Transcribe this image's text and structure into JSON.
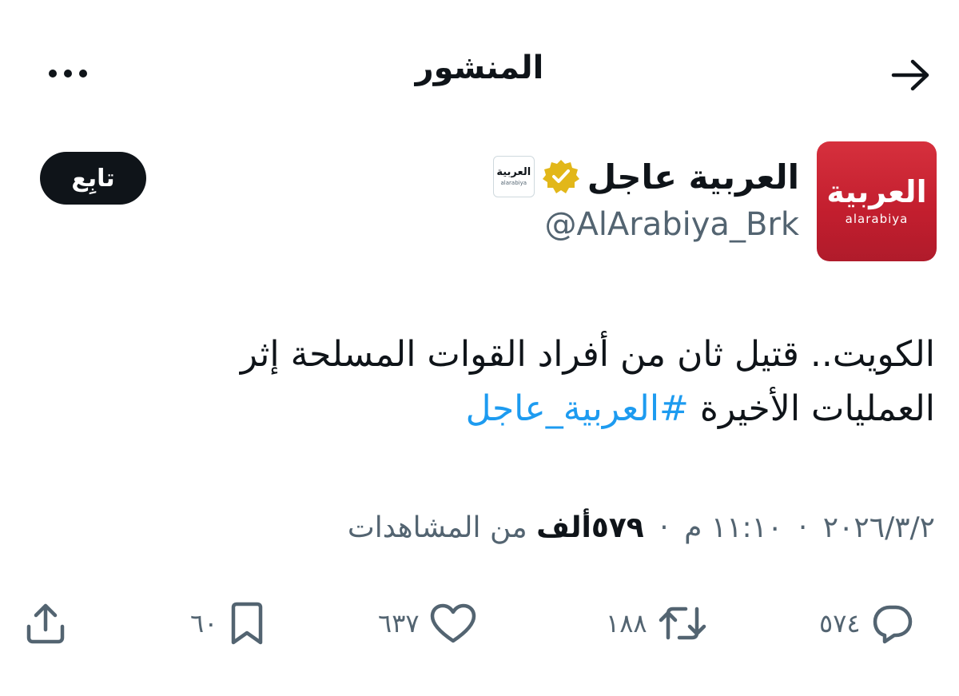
{
  "header": {
    "title": "المنشور"
  },
  "author": {
    "display_name": "العربية عاجل",
    "handle": "@AlArabiya_Brk",
    "avatar_logo_ar": "العربية",
    "avatar_logo_en": "alarabiya",
    "affiliate_badge_ar": "العربية",
    "affiliate_badge_en": "alarabiya",
    "follow_label": "تابِع"
  },
  "tweet": {
    "text": "الكويت.. قتيل ثان من أفراد القوات المسلحة إثر العمليات الأخيرة",
    "hashtag": "#العربية_عاجل"
  },
  "meta": {
    "time": "١١:١٠ م",
    "date": "٢٠٢٦/٣/٢",
    "views_count": "٥٧٩ألف",
    "views_label": "من المشاهدات",
    "separator": "·"
  },
  "actions": {
    "replies": "٥٧٤",
    "retweets": "١٨٨",
    "likes": "٦٣٧",
    "bookmarks": "٦٠"
  },
  "colors": {
    "text": "#0f1419",
    "secondary": "#536471",
    "link": "#1d9bf0",
    "avatar_red": "#c21e2e",
    "verified_gold": "#e2b719"
  },
  "icons": {
    "more": "more-dots-icon",
    "back": "arrow-right-icon",
    "verified": "verified-badge-icon",
    "reply": "reply-icon",
    "retweet": "retweet-icon",
    "like": "heart-icon",
    "bookmark": "bookmark-icon",
    "share": "share-icon"
  }
}
